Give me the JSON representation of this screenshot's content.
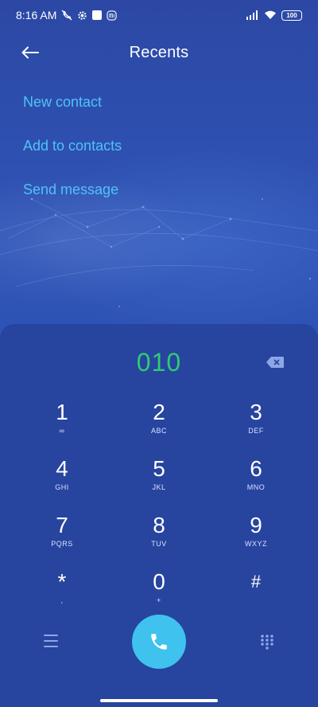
{
  "status_bar": {
    "time": "8:16 AM",
    "battery": "100"
  },
  "header": {
    "title": "Recents"
  },
  "actions": [
    "New contact",
    "Add to contacts",
    "Send message"
  ],
  "dialer": {
    "number": "010",
    "keys": [
      {
        "digit": "1",
        "sub": "∞"
      },
      {
        "digit": "2",
        "sub": "ABC"
      },
      {
        "digit": "3",
        "sub": "DEF"
      },
      {
        "digit": "4",
        "sub": "GHI"
      },
      {
        "digit": "5",
        "sub": "JKL"
      },
      {
        "digit": "6",
        "sub": "MNO"
      },
      {
        "digit": "7",
        "sub": "PQRS"
      },
      {
        "digit": "8",
        "sub": "TUV"
      },
      {
        "digit": "9",
        "sub": "WXYZ"
      },
      {
        "digit": "*",
        "sub": ","
      },
      {
        "digit": "0",
        "sub": "+"
      },
      {
        "digit": "#",
        "sub": ""
      }
    ]
  },
  "colors": {
    "accent_link": "#4fc3f7",
    "number_green": "#2ecc71",
    "call_button": "#3fc2ee",
    "background": "#2a4aa6"
  }
}
